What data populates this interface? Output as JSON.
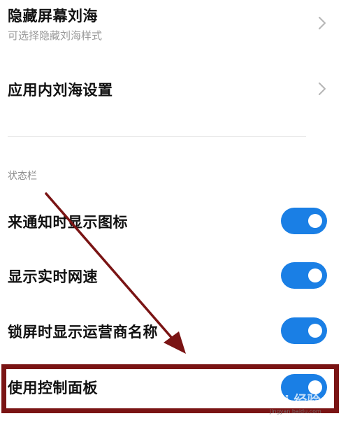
{
  "settings": {
    "hide_notch": {
      "title": "隐藏屏幕刘海",
      "subtitle": "可选择隐藏刘海样式"
    },
    "app_notch": {
      "title": "应用内刘海设置"
    }
  },
  "status_bar": {
    "header": "状态栏",
    "items": [
      {
        "label": "来通知时显示图标",
        "enabled": true
      },
      {
        "label": "显示实时网速",
        "enabled": true
      },
      {
        "label": "锁屏时显示运营商名称",
        "enabled": true
      },
      {
        "label": "使用控制面板",
        "enabled": true
      }
    ]
  },
  "watermark": {
    "brand": "Bai 经验",
    "url": "jingyan.baidu.com"
  },
  "colors": {
    "accent": "#1a7fe5",
    "annotation": "#7a1414"
  }
}
